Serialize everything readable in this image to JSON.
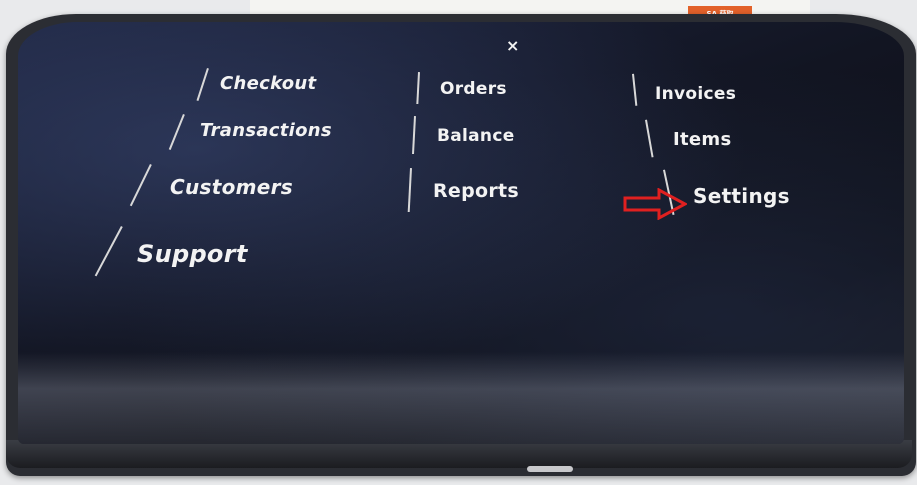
{
  "window": {
    "close_glyph": "×"
  },
  "menu": {
    "checkout": "Checkout",
    "orders": "Orders",
    "invoices": "Invoices",
    "transactions": "Transactions",
    "balance": "Balance",
    "items": "Items",
    "customers": "Customers",
    "reports": "Reports",
    "settings": "Settings",
    "support": "Support"
  },
  "annotation": {
    "arrow_color": "#e02020",
    "arrow_icon": "right-arrow-icon"
  },
  "background": {
    "badge_text": "SA 获取"
  }
}
